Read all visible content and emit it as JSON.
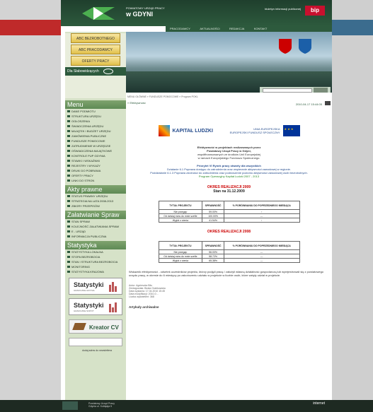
{
  "top": {
    "line1": "POWIATOWY URZĄD PRACY",
    "line2": "w GDYNI",
    "bip_text": "biuletyn informacji publicznej",
    "bip": "bip"
  },
  "nav": [
    "PRACODAWCY",
    "AKTUALNOŚCI",
    "REDAKCJA",
    "KONTAKT"
  ],
  "sidebar": {
    "buttons": [
      "ABC BEZROBOTNEGO",
      "ABC PRACODAWCY",
      "OFERTY PRACY"
    ],
    "dla": "Dla Słabowidzących",
    "menu_title": "Menu",
    "menu_items": [
      "DANE PODMIOTU",
      "STRUKTURA URZĘDU",
      "OGŁOSZENIA",
      "ŚWIADCZENIA URZĘDU",
      "MAJĄTEK I BUDŻET URZĘDU",
      "ZAMÓWIENIA PUBLICZNE",
      "FUNDUSZE POMOCOWE",
      "ZATRUDNIENIE W URZĘDZIE",
      "OŚWIADCZENIA MAJĄTKOWE",
      "KONTROLE PUP GDYNIA",
      "STAWKI I WSKAŹNIKI",
      "REJESTRY I WYKAZY",
      "DRUKI DO POBRANIA",
      "OFERTY PRACY",
      "LINKI DO STRON"
    ],
    "akty_title": "Akty prawne",
    "akty_items": [
      "STATUS PRAWNY URZĘDU",
      "STRATEGIA NA LATA 2008-2013",
      "ZBIORY PRZEPISÓW"
    ],
    "zal_title": "Załatwianie Spraw",
    "zal_items": [
      "STAN SPRAW",
      "KOLEJNOŚĆ ZAŁATWIANIA SPRAW",
      "E - URZĄD",
      "INFORMACJA PUBLICZNA"
    ],
    "stat_title": "Statystyka",
    "stat_items": [
      "STATYSTYKA LOKALNA",
      "STOPA BEZROBOCIA",
      "STAN I STRUKTURA BEZROBOCIA",
      "MONITORING",
      "STATYSTYKA KRAJOWA"
    ],
    "stat_box1": {
      "title": "Statystyki",
      "sub": "GRAFICZNE GDYNIA"
    },
    "stat_box2": {
      "title": "Statystyki",
      "sub": "GRAFICZNE SOPOT"
    },
    "kreator": "Kreator CV",
    "newsletter": "dodaj adres do newslettera"
  },
  "content": {
    "crumb": "MENU GŁÓWNE » FUNDUSZE POMOCOWE » Program POKL",
    "efekt": "» Efektywność",
    "date": "2010-04-17 15:44:05",
    "eu_left": "KAPITAŁ LUDZKI",
    "eu_right1": "UNIA EUROPEJSKA",
    "eu_right2": "EUROPEJSKI FUNDUSZ SPOŁECZNY",
    "p1": "Efektywność w projektach realizowanych przez",
    "p2": "Powiatowy Urząd Pracy w Gdyni,",
    "p3": "współfinansowanych ze środków Unii Europejskiej",
    "p4": "w ramach Europejskiego Funduszu Społecznego.",
    "p5": "Priorytet VI Rynek pracy otwarty dla wszystkich",
    "p6": "Działanie 6.1 Poprawa dostępu do zatrudnienia oraz wspieranie aktywności zawodowej w regionie.",
    "p7": "Poddziałanie 6.1.3 Poprawa zdolności do zatrudnienia oraz podnoszenie poziomu aktywności zawodowej osób bezrobotnych.",
    "p8": "Program Operacyjny Kapitał Ludzki 2007 - 2013",
    "period1": "OKRES REALIZACJI 2009",
    "period1b": "Stan na 31.12.2009",
    "table_head": [
      "TYTUŁ PROJEKTU",
      "SPRAWNOŚĆ",
      "% PORÓWNANIU DO POPRZEDNIEGO MIESIĄCA"
    ],
    "table1": [
      [
        "Nie przegap",
        "59.00%",
        "↑"
      ],
      [
        "Od dzisiaj mów do mnie szefie",
        "100.00%",
        "---"
      ],
      [
        "Wyjdź z cienia",
        "41.54%",
        "↑"
      ]
    ],
    "period2": "OKRES REALIZACJI 2008",
    "table2": [
      [
        "Nie przegap",
        "56.00%",
        "---"
      ],
      [
        "Od dzisiaj mów do mnie szefie",
        "58.72%",
        "---"
      ],
      [
        "Wyjdź z cienia",
        "65.38%",
        "---"
      ]
    ],
    "bottom": "Wskaźnik efektywności - odsetek uczestników projektu, którzy podjęli pracę / założyli własną działalność gospodarczą lub wyrejestrowali się z powiatowego urzędu pracy, w okresie do 6 miesięcy po zakończeniu udziału w projekcie w liczbie osób, które wzięły udział w projekcie.",
    "meta1": "Autor: Agnieszka Bilo",
    "meta2": "Zredagowała: Beata Grabkowska",
    "meta3": "Data wysłania: 17.04.2010 15:45",
    "meta4": "Data modyfikacji: 2010-0…",
    "meta5": "Liczba wyświetleń: 368",
    "arch": "Artykuły archiwalne"
  },
  "footer": {
    "center": "Powiatowy Urząd Pracy Gdynia ul. Kołłątaja 5",
    "right": "internet"
  }
}
